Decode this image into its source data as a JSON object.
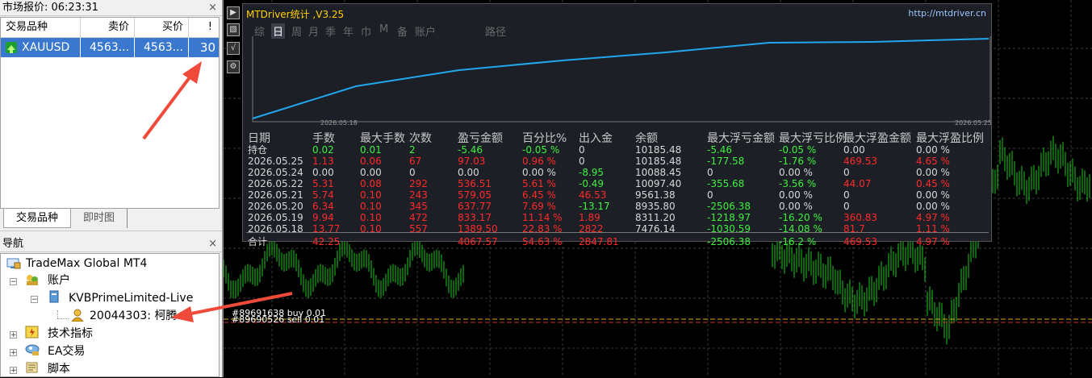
{
  "market_watch": {
    "title": "市场报价: 06:23:31",
    "close": "×",
    "columns": [
      "交易品种",
      "卖价",
      "买价",
      "!"
    ],
    "rows": [
      {
        "symbol": "XAUUSD",
        "bid": "4563...",
        "ask": "4563...",
        "spread": "30"
      }
    ],
    "tabs": [
      "交易品种",
      "即时图"
    ]
  },
  "navigator": {
    "title": "导航",
    "close": "×",
    "items": [
      {
        "label": "TradeMax Global MT4",
        "icon": "terminal-icon"
      },
      {
        "label": "账户",
        "icon": "accounts-icon"
      },
      {
        "label": "KVBPrimeLimited-Live",
        "icon": "server-icon"
      },
      {
        "label": "20044303: 柯腾",
        "icon": "account-user-icon"
      },
      {
        "label": "技术指标",
        "icon": "indicator-icon"
      },
      {
        "label": "EA交易",
        "icon": "expert-advisor-icon"
      },
      {
        "label": "脚本",
        "icon": "script-icon"
      }
    ]
  },
  "stats_panel": {
    "title": "MTDriver统计  ,V3.25",
    "url": "http://mtdriver.cn",
    "tabs": [
      "综",
      "日",
      "周",
      "月",
      "季",
      "年",
      "巾",
      "M",
      "备",
      "账户",
      "路径"
    ],
    "equity_dates": [
      "2026.05.18",
      "2026.05.25"
    ],
    "headers": [
      "日期",
      "手数",
      "最大手数",
      "次数",
      "盈亏金额",
      "百分比%",
      "出入金",
      "余额",
      "最大浮亏金额",
      "最大浮亏比例",
      "最大浮盈金额",
      "最大浮盈比例"
    ],
    "rows": [
      [
        "持仓",
        "0.02",
        "0.01",
        "2",
        "-5.46",
        "-0.05 %",
        "0",
        "10185.48",
        "-5.46",
        "-0.05 %",
        "0.00",
        "0.00 %"
      ],
      [
        "2026.05.25",
        "1.13",
        "0.06",
        "67",
        "97.03",
        "0.96 %",
        "0",
        "10185.48",
        "-177.58",
        "-1.76 %",
        "469.53",
        "4.65 %"
      ],
      [
        "2026.05.24",
        "0.00",
        "0.00",
        "0",
        "0.00",
        "0.00 %",
        "-8.95",
        "10088.45",
        "0",
        "0.00 %",
        "0",
        "0.00 %"
      ],
      [
        "2026.05.22",
        "5.31",
        "0.08",
        "292",
        "536.51",
        "5.61 %",
        "-0.49",
        "10097.40",
        "-355.68",
        "-3.56 %",
        "44.07",
        "0.45 %"
      ],
      [
        "2026.05.21",
        "5.74",
        "0.10",
        "243",
        "579.05",
        "6.45 %",
        "46.53",
        "9561.38",
        "0",
        "0.00 %",
        "0",
        "0.00 %"
      ],
      [
        "2026.05.20",
        "6.34",
        "0.10",
        "345",
        "637.77",
        "7.69 %",
        "-13.17",
        "8935.80",
        "-2506.38",
        "0.00 %",
        "0",
        "0.00 %"
      ],
      [
        "2026.05.19",
        "9.94",
        "0.10",
        "472",
        "833.17",
        "11.14 %",
        "1.89",
        "8311.20",
        "-1218.97",
        "-16.20 %",
        "360.83",
        "4.97 %"
      ],
      [
        "2026.05.18",
        "13.77",
        "0.10",
        "557",
        "1389.50",
        "22.83 %",
        "2822",
        "7476.14",
        "-1030.59",
        "-14.08 %",
        "81.7",
        "1.11 %"
      ],
      [
        "合计",
        "42.25",
        "",
        "",
        "4067.57",
        "54.63 %",
        "2847.81",
        "",
        "-2506.38",
        "-16.2 %",
        "469.53",
        "4.97 %"
      ]
    ]
  },
  "orders": [
    "#89691638 buy 0.01",
    "#89690526 sell 0.01"
  ],
  "colors": {
    "positive": "#3df03d",
    "negative": "#ff2a2a",
    "equity_line": "#22a6ee",
    "selected_row": "#3a78d0"
  }
}
